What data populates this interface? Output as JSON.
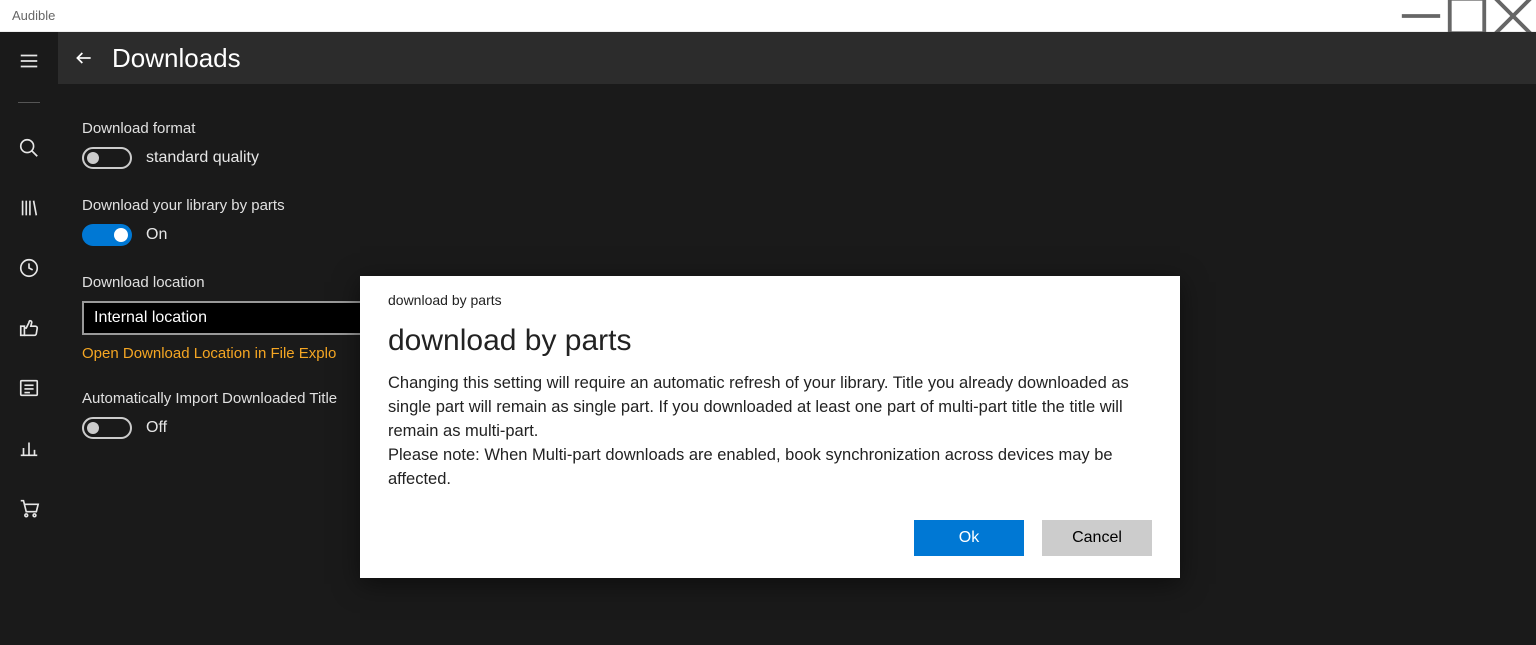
{
  "titlebar": {
    "app_name": "Audible"
  },
  "header": {
    "page_title": "Downloads"
  },
  "settings": {
    "format_label": "Download format",
    "format_value": "standard quality",
    "parts_label": "Download your library by parts",
    "parts_value": "On",
    "location_label": "Download location",
    "location_value": "Internal location",
    "open_link": "Open Download Location in File Explo",
    "autoimport_label": "Automatically Import Downloaded Title",
    "autoimport_value": "Off"
  },
  "dialog": {
    "small_title": "download by parts",
    "title": "download by parts",
    "body_p1": "Changing this setting will require an automatic refresh of your library. Title you already downloaded as single part will remain as single part. If you downloaded at least one part of multi-part title the title will remain as multi-part.",
    "body_p2": "Please note: When Multi-part downloads are enabled, book synchronization across devices may be affected.",
    "ok": "Ok",
    "cancel": "Cancel"
  }
}
